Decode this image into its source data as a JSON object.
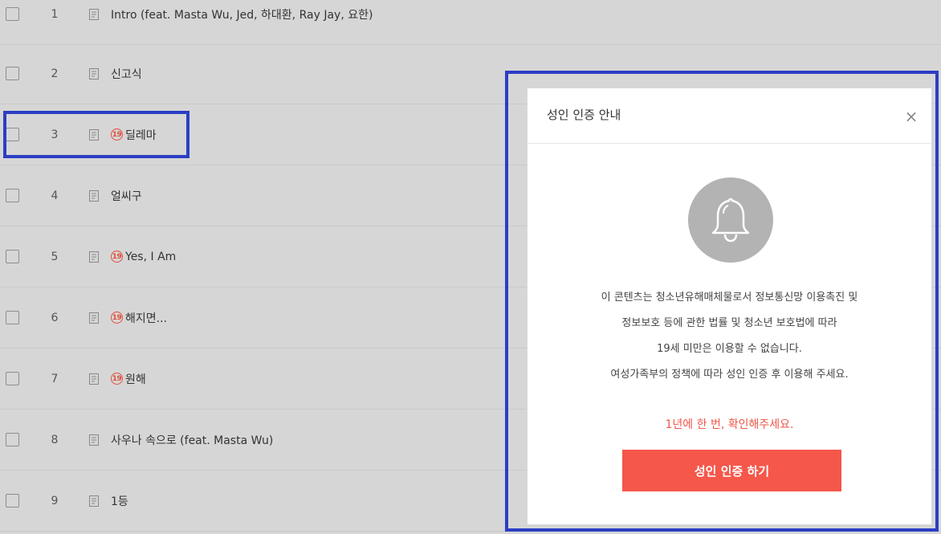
{
  "tracks": [
    {
      "num": "1",
      "title": "Intro (feat. Masta Wu, Jed, 하대환, Ray Jay, 요한)",
      "adult": false
    },
    {
      "num": "2",
      "title": "신고식",
      "adult": false
    },
    {
      "num": "3",
      "title": "딜레마",
      "adult": true
    },
    {
      "num": "4",
      "title": "얼씨구",
      "adult": false
    },
    {
      "num": "5",
      "title": "Yes, I Am",
      "adult": true
    },
    {
      "num": "6",
      "title": "해지면...",
      "adult": true
    },
    {
      "num": "7",
      "title": "원해",
      "adult": true
    },
    {
      "num": "8",
      "title": "사우나 속으로 (feat. Masta Wu)",
      "adult": false
    },
    {
      "num": "9",
      "title": "1등",
      "adult": false
    }
  ],
  "age_badge": "19",
  "modal": {
    "title": "성인 인증 안내",
    "close": "×",
    "body_lines": [
      "이 콘텐츠는 청소년유해매체물로서 정보통신망 이용촉진 및",
      "정보보호 등에 관한 법률 및 청소년 보호법에 따라",
      "19세 미만은 이용할 수 없습니다.",
      "여성가족부의 정책에 따라 성인 인증 후 이용해 주세요."
    ],
    "annual_notice": "1년에 한 번, 확인해주세요.",
    "button_label": "성인 인증 하기"
  },
  "icons": {
    "document": "document-icon",
    "bell": "bell-icon",
    "close": "close-icon"
  },
  "colors": {
    "accent": "#f5574a",
    "badge": "#e24d3b",
    "highlight": "#2b3ec4",
    "overlay_bg": "#d6d6d6"
  }
}
